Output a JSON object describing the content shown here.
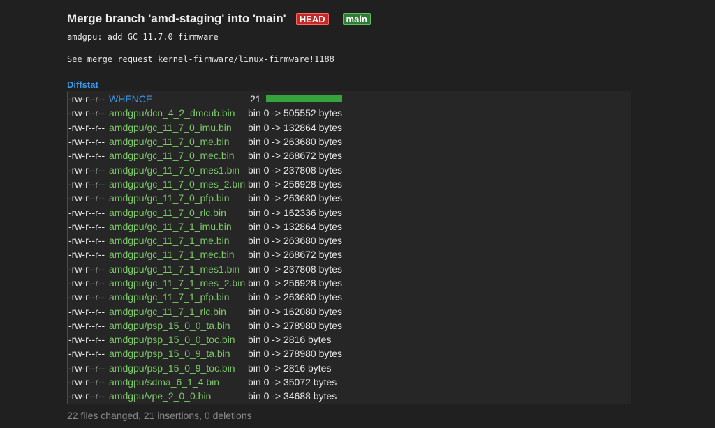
{
  "commit": {
    "title": "Merge branch 'amd-staging' into 'main'",
    "head_badge": "HEAD",
    "branch_badge": "main",
    "subject": "amdgpu: add GC 11.7.0 firmware",
    "body": "See merge request kernel-firmware/linux-firmware!1188"
  },
  "diffstat": {
    "header": "Diffstat",
    "bar_color": "#35a33b",
    "rows": [
      {
        "mode": "-rw-r--r--",
        "file": "WHENCE",
        "stat": "21",
        "graph": 21
      },
      {
        "mode": "-rw-r--r--",
        "file": "amdgpu/dcn_4_2_dmcub.bin",
        "stat": "bin 0 -> 505552 bytes"
      },
      {
        "mode": "-rw-r--r--",
        "file": "amdgpu/gc_11_7_0_imu.bin",
        "stat": "bin 0 -> 132864 bytes"
      },
      {
        "mode": "-rw-r--r--",
        "file": "amdgpu/gc_11_7_0_me.bin",
        "stat": "bin 0 -> 263680 bytes"
      },
      {
        "mode": "-rw-r--r--",
        "file": "amdgpu/gc_11_7_0_mec.bin",
        "stat": "bin 0 -> 268672 bytes"
      },
      {
        "mode": "-rw-r--r--",
        "file": "amdgpu/gc_11_7_0_mes1.bin",
        "stat": "bin 0 -> 237808 bytes"
      },
      {
        "mode": "-rw-r--r--",
        "file": "amdgpu/gc_11_7_0_mes_2.bin",
        "stat": "bin 0 -> 256928 bytes"
      },
      {
        "mode": "-rw-r--r--",
        "file": "amdgpu/gc_11_7_0_pfp.bin",
        "stat": "bin 0 -> 263680 bytes"
      },
      {
        "mode": "-rw-r--r--",
        "file": "amdgpu/gc_11_7_0_rlc.bin",
        "stat": "bin 0 -> 162336 bytes"
      },
      {
        "mode": "-rw-r--r--",
        "file": "amdgpu/gc_11_7_1_imu.bin",
        "stat": "bin 0 -> 132864 bytes"
      },
      {
        "mode": "-rw-r--r--",
        "file": "amdgpu/gc_11_7_1_me.bin",
        "stat": "bin 0 -> 263680 bytes"
      },
      {
        "mode": "-rw-r--r--",
        "file": "amdgpu/gc_11_7_1_mec.bin",
        "stat": "bin 0 -> 268672 bytes"
      },
      {
        "mode": "-rw-r--r--",
        "file": "amdgpu/gc_11_7_1_mes1.bin",
        "stat": "bin 0 -> 237808 bytes"
      },
      {
        "mode": "-rw-r--r--",
        "file": "amdgpu/gc_11_7_1_mes_2.bin",
        "stat": "bin 0 -> 256928 bytes"
      },
      {
        "mode": "-rw-r--r--",
        "file": "amdgpu/gc_11_7_1_pfp.bin",
        "stat": "bin 0 -> 263680 bytes"
      },
      {
        "mode": "-rw-r--r--",
        "file": "amdgpu/gc_11_7_1_rlc.bin",
        "stat": "bin 0 -> 162080 bytes"
      },
      {
        "mode": "-rw-r--r--",
        "file": "amdgpu/psp_15_0_0_ta.bin",
        "stat": "bin 0 -> 278980 bytes"
      },
      {
        "mode": "-rw-r--r--",
        "file": "amdgpu/psp_15_0_0_toc.bin",
        "stat": "bin 0 -> 2816 bytes"
      },
      {
        "mode": "-rw-r--r--",
        "file": "amdgpu/psp_15_0_9_ta.bin",
        "stat": "bin 0 -> 278980 bytes"
      },
      {
        "mode": "-rw-r--r--",
        "file": "amdgpu/psp_15_0_9_toc.bin",
        "stat": "bin 0 -> 2816 bytes"
      },
      {
        "mode": "-rw-r--r--",
        "file": "amdgpu/sdma_6_1_4.bin",
        "stat": "bin 0 -> 35072 bytes"
      },
      {
        "mode": "-rw-r--r--",
        "file": "amdgpu/vpe_2_0_0.bin",
        "stat": "bin 0 -> 34688 bytes"
      }
    ],
    "summary": "22 files changed, 21 insertions, 0 deletions"
  }
}
